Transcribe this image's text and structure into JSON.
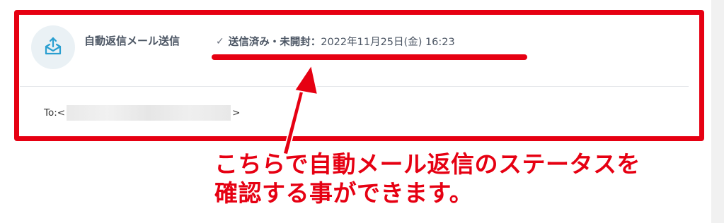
{
  "email_header": {
    "avatar_icon": "envelope-upload-icon",
    "sender_name": "自動返信メール送信",
    "status_check_icon": "check-icon",
    "status_check_glyph": "✓",
    "status_label": "送信済み・未開封：",
    "status_datetime": "2022年11月25日(金) 16:23",
    "to_prefix": "To:<",
    "to_suffix": ">"
  },
  "annotation": {
    "line1": "こちらで自動メール返信のステータスを",
    "line2": "確認する事ができます。"
  },
  "colors": {
    "highlight_red": "#e60012",
    "avatar_bg": "#eaf1f5",
    "icon_blue": "#2a9fd0",
    "text_gray": "#4b5563"
  }
}
